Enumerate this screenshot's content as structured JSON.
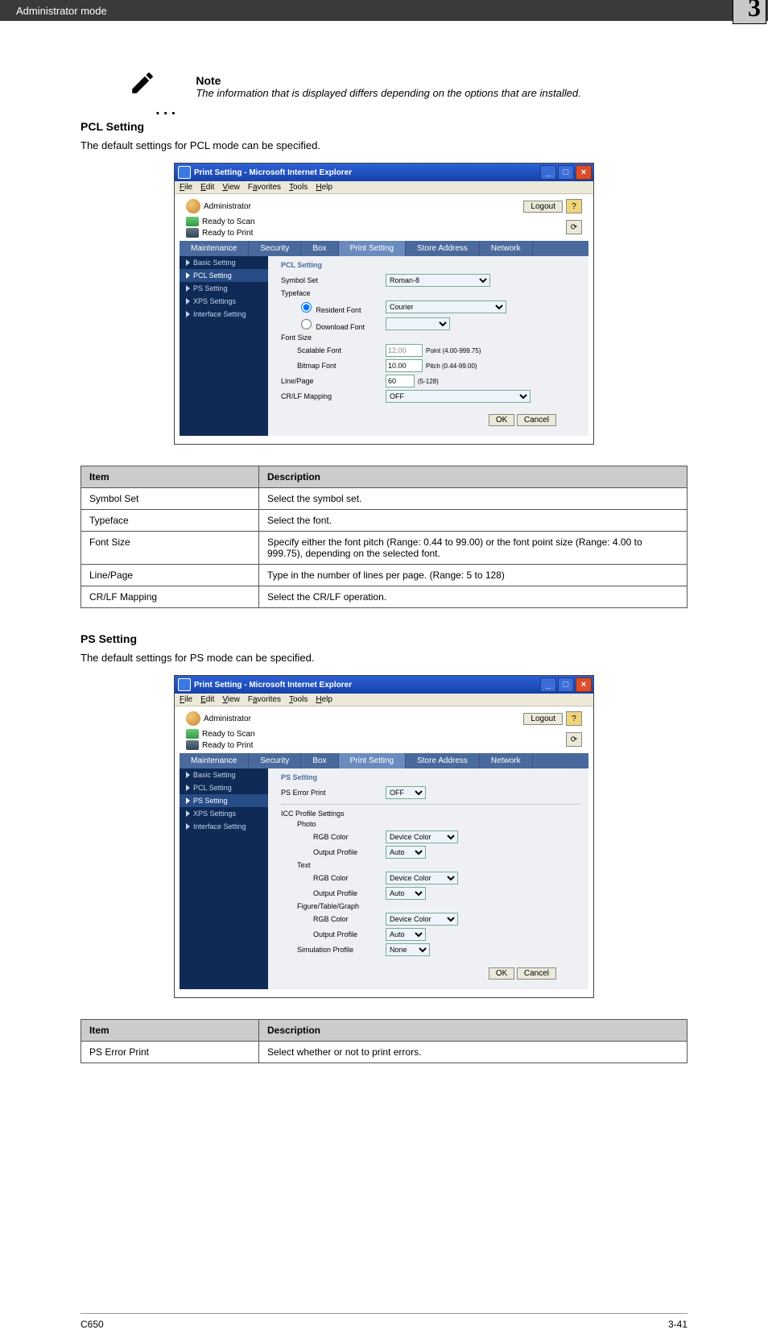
{
  "chapter": "3",
  "header_title": "Administrator mode",
  "note": {
    "label": "Note",
    "text": "The information that is displayed differs depending on the options that are installed."
  },
  "pcl": {
    "heading": "PCL Setting",
    "desc": "The default settings for PCL mode can be specified."
  },
  "ps": {
    "heading": "PS Setting",
    "desc": "The default settings for PS mode can be specified."
  },
  "ie": {
    "title": "Print Setting - Microsoft Internet Explorer",
    "menu": {
      "file": "File",
      "edit": "Edit",
      "view": "View",
      "favorites": "Favorites",
      "tools": "Tools",
      "help": "Help"
    },
    "admin": "Administrator",
    "logout": "Logout",
    "status_scan": "Ready to Scan",
    "status_print": "Ready to Print",
    "tabs": {
      "maintenance": "Maintenance",
      "security": "Security",
      "box": "Box",
      "print": "Print Setting",
      "store": "Store Address",
      "network": "Network"
    },
    "sidebar": {
      "basic": "Basic Setting",
      "pcl": "PCL Setting",
      "ps": "PS Setting",
      "xps": "XPS Settings",
      "interface": "Interface Setting"
    },
    "ok": "OK",
    "cancel": "Cancel"
  },
  "pcl_panel": {
    "title": "PCL Setting",
    "symbol_set_label": "Symbol Set",
    "symbol_set_value": "Roman-8",
    "typeface_label": "Typeface",
    "resident_label": "Resident Font",
    "resident_value": "Courier",
    "download_label": "Download Font",
    "download_value": "",
    "fontsize_label": "Font Size",
    "scalable_label": "Scalable Font",
    "scalable_value": "12.00",
    "scalable_hint": "Point (4.00-999.75)",
    "bitmap_label": "Bitmap Font",
    "bitmap_value": "10.00",
    "bitmap_hint": "Pitch (0.44-99.00)",
    "line_label": "Line/Page",
    "line_value": "60",
    "line_hint": "(5-128)",
    "crlf_label": "CR/LF Mapping",
    "crlf_value": "OFF"
  },
  "ps_panel": {
    "title": "PS Setting",
    "pserr_label": "PS Error Print",
    "pserr_value": "OFF",
    "icc_heading": "ICC Profile Settings",
    "photo": "Photo",
    "text": "Text",
    "fig": "Figure/Table/Graph",
    "rgb": "RGB Color",
    "output": "Output Profile",
    "sim": "Simulation Profile",
    "device_color": "Device Color",
    "auto": "Auto",
    "none": "None"
  },
  "table1": {
    "h1": "Item",
    "h2": "Description",
    "rows": [
      {
        "c1": "Symbol Set",
        "c2": "Select the symbol set."
      },
      {
        "c1": "Typeface",
        "c2": "Select the font."
      },
      {
        "c1": "Font Size",
        "c2": "Specify either the font pitch (Range: 0.44 to 99.00) or the font point size (Range: 4.00 to 999.75), depending on the selected font."
      },
      {
        "c1": "Line/Page",
        "c2": "Type in the number of lines per page. (Range: 5 to 128)"
      },
      {
        "c1": "CR/LF Mapping",
        "c2": "Select the CR/LF operation."
      }
    ]
  },
  "table2": {
    "h1": "Item",
    "h2": "Description",
    "rows": [
      {
        "c1": "PS Error Print",
        "c2": "Select whether or not to print errors."
      }
    ]
  },
  "footer": {
    "left": "C650",
    "right": "3-41"
  }
}
